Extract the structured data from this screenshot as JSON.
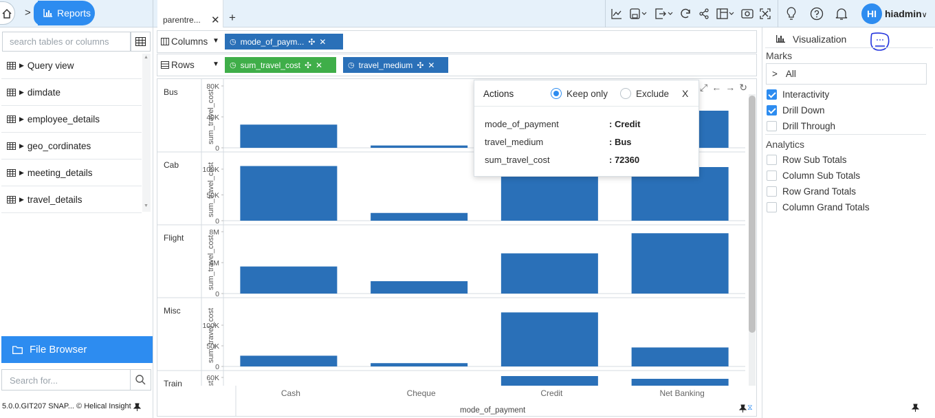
{
  "app": {
    "breadcrumb_label": "Reports",
    "user": {
      "initials": "HI",
      "name": "hiadmin"
    }
  },
  "tabs": [
    {
      "label": "parentre..."
    }
  ],
  "left_panel": {
    "search_placeholder": "search tables or columns",
    "tables": [
      "Query view",
      "dimdate",
      "employee_details",
      "geo_cordinates",
      "meeting_details",
      "travel_details"
    ],
    "file_browser_label": "File Browser",
    "search_for_placeholder": "Search for...",
    "version_text": "5.0.0.GIT207 SNAP...",
    "brand_text": "© Helical Insight"
  },
  "shelves": {
    "columns_label": "Columns",
    "rows_label": "Rows",
    "columns": [
      {
        "label": "mode_of_paym..."
      }
    ],
    "rows": [
      {
        "label": "sum_travel_cost"
      },
      {
        "label": "travel_medium"
      }
    ]
  },
  "popup": {
    "title": "Actions",
    "keep_only": "Keep only",
    "exclude": "Exclude",
    "close": "X",
    "rows": [
      {
        "key": "mode_of_payment",
        "value": ": Credit"
      },
      {
        "key": "travel_medium",
        "value": ": Bus"
      },
      {
        "key": "sum_travel_cost",
        "value": ": 72360"
      }
    ]
  },
  "right_panel": {
    "title": "Visualization",
    "marks_label": "Marks",
    "all_label": "All",
    "options": [
      {
        "label": "Interactivity",
        "checked": true
      },
      {
        "label": "Drill Down",
        "checked": true
      },
      {
        "label": "Drill Through",
        "checked": false
      }
    ],
    "analytics_label": "Analytics",
    "analytics": [
      {
        "label": "Row Sub Totals",
        "checked": false
      },
      {
        "label": "Column Sub Totals",
        "checked": false
      },
      {
        "label": "Row Grand Totals",
        "checked": false
      },
      {
        "label": "Column Grand Totals",
        "checked": false
      }
    ]
  },
  "chart_data": {
    "type": "bar",
    "xlabel": "mode_of_payment",
    "ylabel": "sum_travel_cost",
    "categories": [
      "Cash",
      "Cheque",
      "Credit",
      "Net Banking"
    ],
    "color": "#2a70b8",
    "panels": [
      {
        "name": "Bus",
        "ylim": [
          0,
          80000
        ],
        "ticks": [
          "80K",
          "40K",
          "0"
        ],
        "values": [
          30000,
          3000,
          72360,
          48000
        ]
      },
      {
        "name": "Cab",
        "ylim": [
          0,
          120000
        ],
        "ticks": [
          "100K",
          "50K",
          "0"
        ],
        "values": [
          106000,
          15000,
          108000,
          104000
        ]
      },
      {
        "name": "Flight",
        "ylim": [
          0,
          8000000
        ],
        "ticks": [
          "8M",
          "4M",
          "0"
        ],
        "values": [
          3500000,
          1600000,
          5200000,
          7800000
        ]
      },
      {
        "name": "Misc",
        "ylim": [
          0,
          150000
        ],
        "ticks": [
          "100K",
          "50K",
          "0"
        ],
        "values": [
          26000,
          8000,
          131000,
          46000
        ]
      },
      {
        "name": "Train",
        "ylim": [
          0,
          60000
        ],
        "ticks": [
          "60K"
        ],
        "values": [
          null,
          null,
          null,
          null
        ]
      }
    ]
  }
}
